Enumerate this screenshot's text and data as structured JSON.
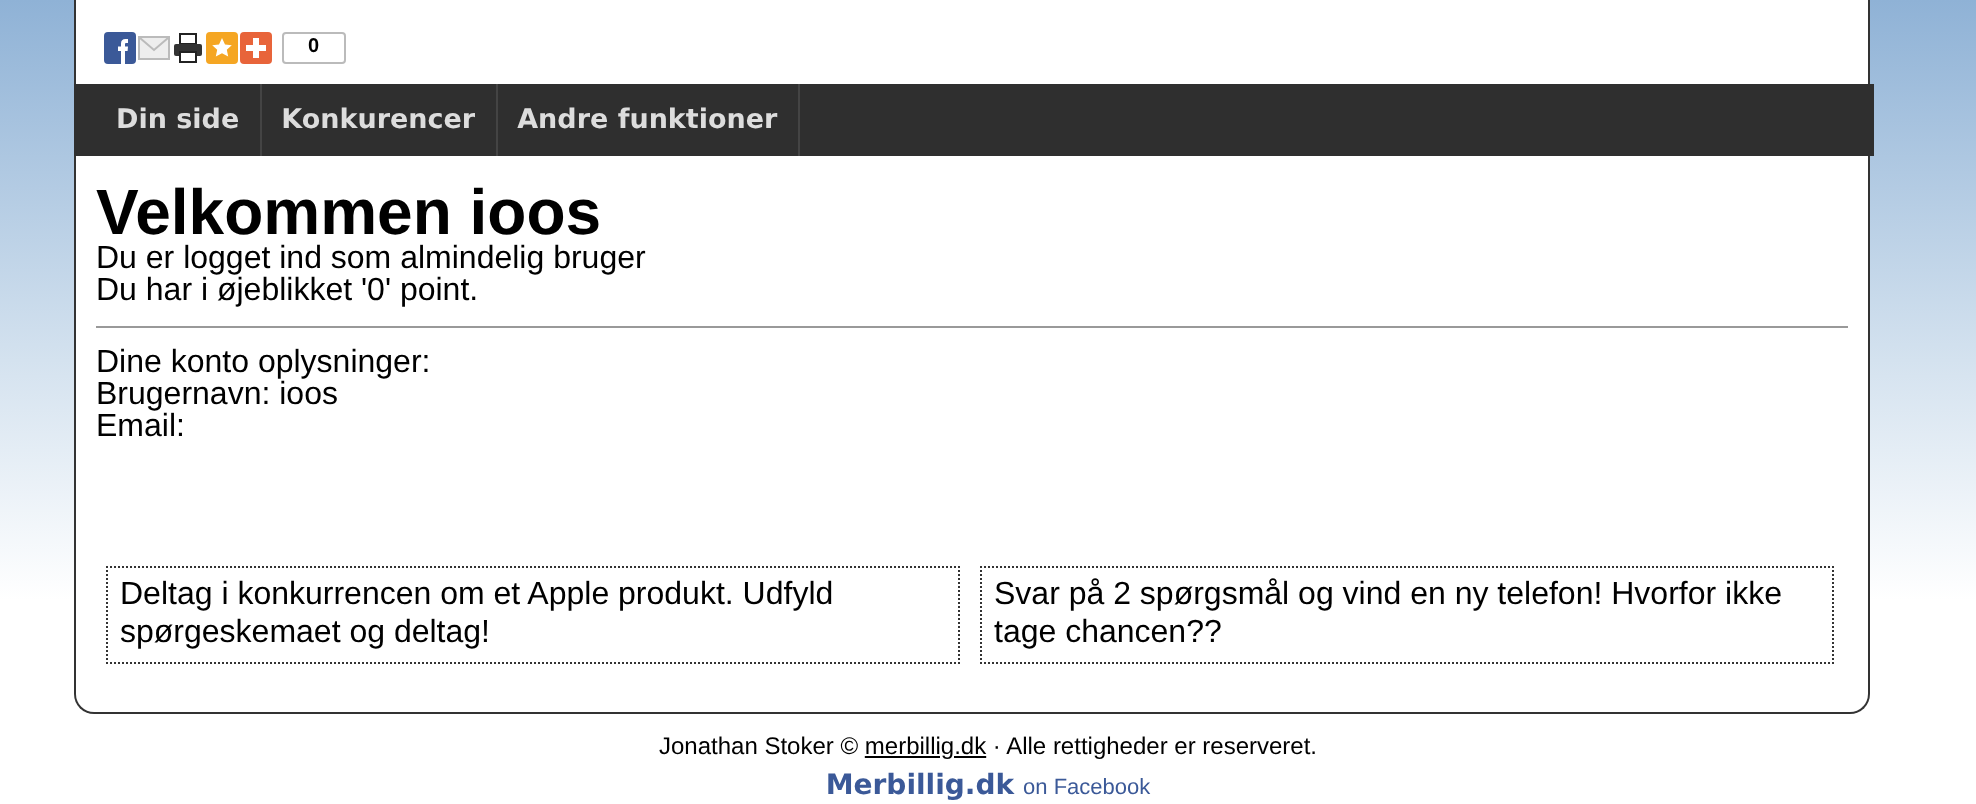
{
  "share_bar": {
    "count": "0"
  },
  "nav": [
    {
      "label": "Din side"
    },
    {
      "label": "Konkurencer"
    },
    {
      "label": "Andre funktioner"
    }
  ],
  "heading": "Velkommen ioos",
  "status_lines": [
    "Du er logget ind som almindelig bruger",
    "Du har i øjeblikket '0' point."
  ],
  "account": {
    "title": "Dine konto oplysninger:",
    "lines": [
      "Brugernavn: ioos",
      "Email:"
    ]
  },
  "promos": [
    "Deltag i konkurrencen om et Apple produkt. Udfyld spørgeskemaet og deltag!",
    "Svar på 2 spørgsmål og vind en ny telefon! Hvorfor ikke tage chancen??"
  ],
  "footer": {
    "owner": "Jonathan Stoker ©",
    "link": "merbillig.dk",
    "rights": "· Alle rettigheder er reserveret."
  },
  "facebook": {
    "name": "Merbillig.dk",
    "suffix": "on Facebook"
  }
}
